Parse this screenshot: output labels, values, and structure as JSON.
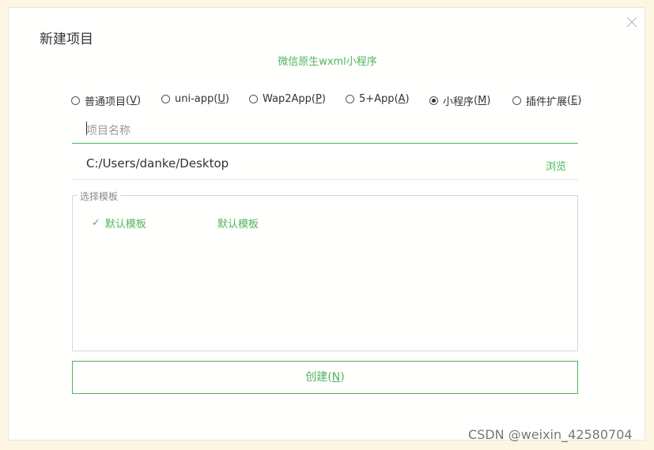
{
  "dialog": {
    "title": "新建项目",
    "subtitle": "微信原生wxml小程序"
  },
  "project_types": [
    {
      "label": "普通项目",
      "shortcut": "V",
      "checked": false
    },
    {
      "label": "uni-app",
      "shortcut": "U",
      "checked": false
    },
    {
      "label": "Wap2App",
      "shortcut": "P",
      "checked": false
    },
    {
      "label": "5+App",
      "shortcut": "A",
      "checked": false
    },
    {
      "label": "小程序",
      "shortcut": "M",
      "checked": true
    },
    {
      "label": "插件扩展",
      "shortcut": "E",
      "checked": false
    }
  ],
  "name_field": {
    "placeholder": "项目名称",
    "value": ""
  },
  "path": {
    "value": "C:/Users/danke/Desktop",
    "browse_label": "浏览"
  },
  "templates": {
    "legend": "选择模板",
    "items": [
      {
        "label": "默认模板",
        "selected": true,
        "icon": "check-icon"
      },
      {
        "label": "默认模板",
        "selected": false
      }
    ]
  },
  "create_button": {
    "label": "创建",
    "shortcut": "N"
  },
  "watermark": "CSDN @weixin_42580704",
  "colors": {
    "accent": "#4fb55a",
    "background": "#fdf6e3"
  }
}
